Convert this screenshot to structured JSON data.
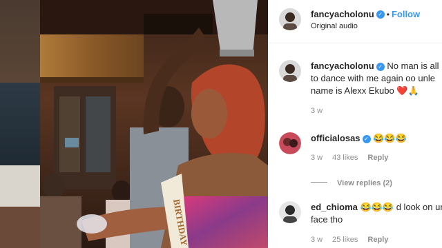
{
  "post": {
    "username": "fancyacholonu",
    "follow_label": "Follow",
    "audio_label": "Original audio",
    "sash_text": "BIRTHDAY"
  },
  "caption": {
    "username": "fancyacholonu",
    "text_line1": "No man is all",
    "text_line2": "to dance with me again oo unle",
    "text_line3": "name is Alexx Ekubo ❤️🙏",
    "time": "3 w"
  },
  "comments": [
    {
      "username": "officialosas",
      "text": "😂😂😂",
      "time": "3 w",
      "likes": "43 likes",
      "reply_label": "Reply",
      "view_replies": "View replies (2)"
    },
    {
      "username": "ed_chioma",
      "text_line1": "😂😂😂 d look on ur",
      "text_line2": "face tho",
      "time": "3 w",
      "likes": "25 likes",
      "reply_label": "Reply"
    }
  ],
  "colors": {
    "accent": "#3897f0",
    "text": "#262626",
    "muted": "#8e8e8e"
  }
}
